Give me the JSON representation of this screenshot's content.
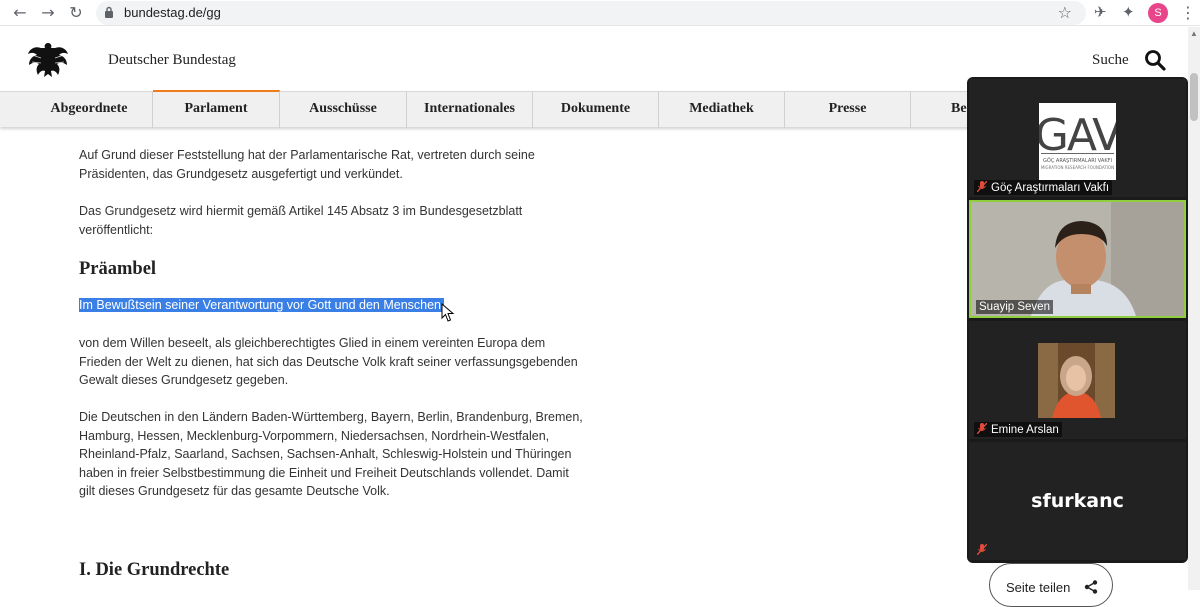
{
  "browser": {
    "url": "bundestag.de/gg",
    "profile_initial": "S"
  },
  "site": {
    "title": "Deutscher Bundestag",
    "search_label": "Suche"
  },
  "nav": {
    "items": [
      "Abgeordnete",
      "Parlament",
      "Ausschüsse",
      "Internationales",
      "Dokumente",
      "Mediathek",
      "Presse",
      "Be"
    ],
    "active": "Parlament",
    "accent_color": "#f07d1c"
  },
  "content": {
    "para1": "Auf Grund dieser Feststellung hat der Parlamentarische Rat, vertreten durch seine Präsidenten, das Grundgesetz ausgefertigt und verkündet.",
    "para2": "Das Grundgesetz wird hiermit gemäß Artikel 145 Absatz 3 im Bundesgesetzblatt veröffentlicht:",
    "heading_praeambel": "Präambel",
    "selected_line": "Im Bewußtsein seiner Verantwortung vor Gott und den Menschen,",
    "para3": "von dem Willen beseelt, als gleichberechtigtes Glied in einem vereinten Europa dem Frieden der Welt zu dienen, hat sich das Deutsche Volk kraft seiner verfassungsgebenden Gewalt dieses Grundgesetz gegeben.",
    "para4": "Die Deutschen in den Ländern Baden-Württemberg, Bayern, Berlin, Brandenburg, Bremen, Hamburg, Hessen, Mecklenburg-Vorpommern, Niedersachsen, Nordrhein-Westfalen, Rheinland-Pfalz, Saarland, Sachsen, Sachsen-Anhalt, Schleswig-Holstein und Thüringen haben in freier Selbstbestimmung die Einheit und Freiheit Deutschlands vollendet. Damit gilt dieses Grundgesetz für das gesamte Deutsche Volk.",
    "heading_grundrechte": "I. Die Grundrechte",
    "selection_color": "#3a7fe5"
  },
  "video": {
    "participants": [
      {
        "name": "Göç Araştırmaları Vakfı",
        "muted": true,
        "logo_text": "GAV",
        "logo_subtext": "GÖÇ ARAŞTIRMALARI VAKFI",
        "logo_subtext2": "MIGRATION RESEARCH FOUNDATION"
      },
      {
        "name": "Suayip Seven",
        "muted": false,
        "active_speaker": true
      },
      {
        "name": "Emine Arslan",
        "muted": true
      },
      {
        "name": "",
        "display_text": "sfurkanc",
        "muted": true
      }
    ],
    "active_border_color": "#8fce3e"
  },
  "share": {
    "label": "Seite teilen"
  }
}
